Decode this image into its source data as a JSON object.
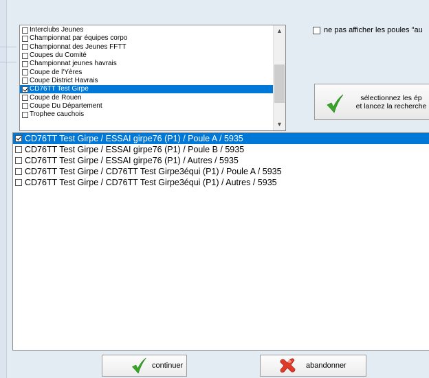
{
  "competitions": {
    "items": [
      {
        "label": "Interclubs Jeunes",
        "checked": false,
        "selected": false
      },
      {
        "label": "Championnat par équipes corpo",
        "checked": false,
        "selected": false
      },
      {
        "label": "Championnat des Jeunes FFTT",
        "checked": false,
        "selected": false
      },
      {
        "label": "Coupes du Comité",
        "checked": false,
        "selected": false
      },
      {
        "label": "Championnat jeunes havrais",
        "checked": false,
        "selected": false
      },
      {
        "label": "Coupe de l'Yères",
        "checked": false,
        "selected": false
      },
      {
        "label": "Coupe District Havrais",
        "checked": false,
        "selected": false
      },
      {
        "label": "CD76TT Test Girpe",
        "checked": true,
        "selected": true
      },
      {
        "label": "Coupe de Rouen",
        "checked": false,
        "selected": false
      },
      {
        "label": "Coupe Du Département",
        "checked": false,
        "selected": false
      },
      {
        "label": "Trophee cauchois",
        "checked": false,
        "selected": false
      }
    ]
  },
  "options": {
    "hide_pools_label": "ne pas afficher les poules \"au"
  },
  "search_button": {
    "line1": "sélectionnez les ép",
    "line2": "et lancez la recherche",
    "icon": "checkmark-icon"
  },
  "pools": {
    "items": [
      {
        "label": "CD76TT Test Girpe / ESSAI girpe76 (P1) / Poule A / 5935",
        "checked": true,
        "selected": true
      },
      {
        "label": "CD76TT Test Girpe / ESSAI girpe76 (P1) / Poule B / 5935",
        "checked": false,
        "selected": false
      },
      {
        "label": "CD76TT Test Girpe / ESSAI girpe76 (P1) / Autres / 5935",
        "checked": false,
        "selected": false
      },
      {
        "label": "CD76TT Test Girpe / CD76TT Test Girpe3équi (P1) / Poule A / 5935",
        "checked": false,
        "selected": false
      },
      {
        "label": "CD76TT Test Girpe / CD76TT Test Girpe3équi (P1) / Autres / 5935",
        "checked": false,
        "selected": false
      }
    ]
  },
  "footer": {
    "continue_label": "continuer",
    "continue_icon": "checkmark-icon",
    "abandon_label": "abandonner",
    "abandon_icon": "cross-icon"
  },
  "colors": {
    "selection": "#0078d7",
    "background": "#e3ebf3",
    "check_green": "#3aa52a",
    "cross_red": "#e03a2a"
  }
}
